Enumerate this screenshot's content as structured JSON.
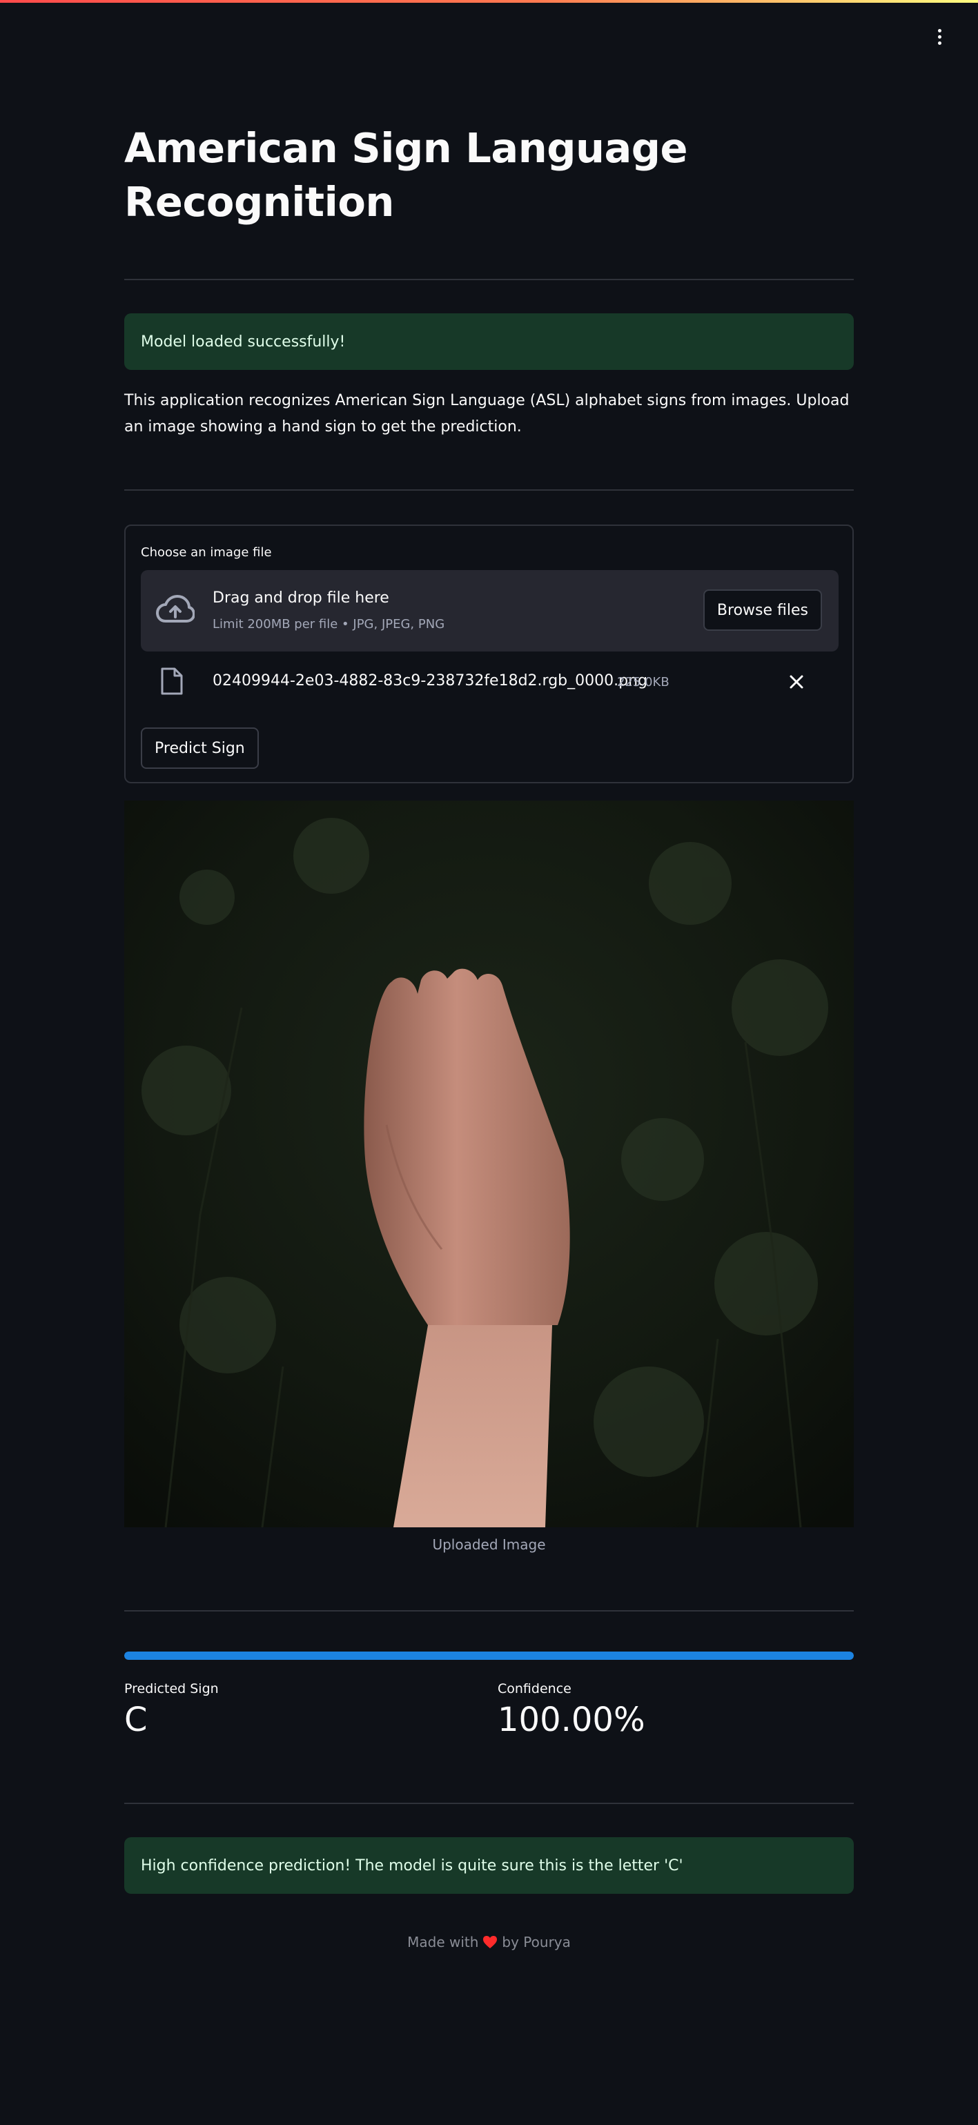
{
  "app": {
    "menu_icon": "vertical-dots-icon",
    "title": "American Sign Language Recognition"
  },
  "status_alert": "Model loaded successfully!",
  "description": "This application recognizes American Sign Language (ASL) alphabet signs from images. Upload an image showing a hand sign to get the prediction.",
  "uploader": {
    "label": "Choose an image file",
    "drop_title": "Drag and drop file here",
    "limit_text": "Limit 200MB per file • JPG, JPEG, PNG",
    "browse_label": "Browse files",
    "file": {
      "name": "02409944-2e03-4882-83c9-238732fe18d2.rgb_0000.png",
      "size": "225.0KB"
    },
    "predict_label": "Predict Sign"
  },
  "image": {
    "caption": "Uploaded Image"
  },
  "result": {
    "progress_fraction": 1.0,
    "progress_color": "#1c83e1",
    "predicted_label": "Predicted Sign",
    "predicted_value": "C",
    "confidence_label": "Confidence",
    "confidence_value": "100.00%"
  },
  "confidence_alert": "High confidence prediction! The model is quite sure this is the letter 'C'",
  "footer": {
    "prefix": "Made with",
    "icon": "heart-icon",
    "suffix": "by Pourya"
  },
  "colors": {
    "background": "#0e1117",
    "success_bg": "#173928",
    "accent": "#ff4b4b"
  }
}
